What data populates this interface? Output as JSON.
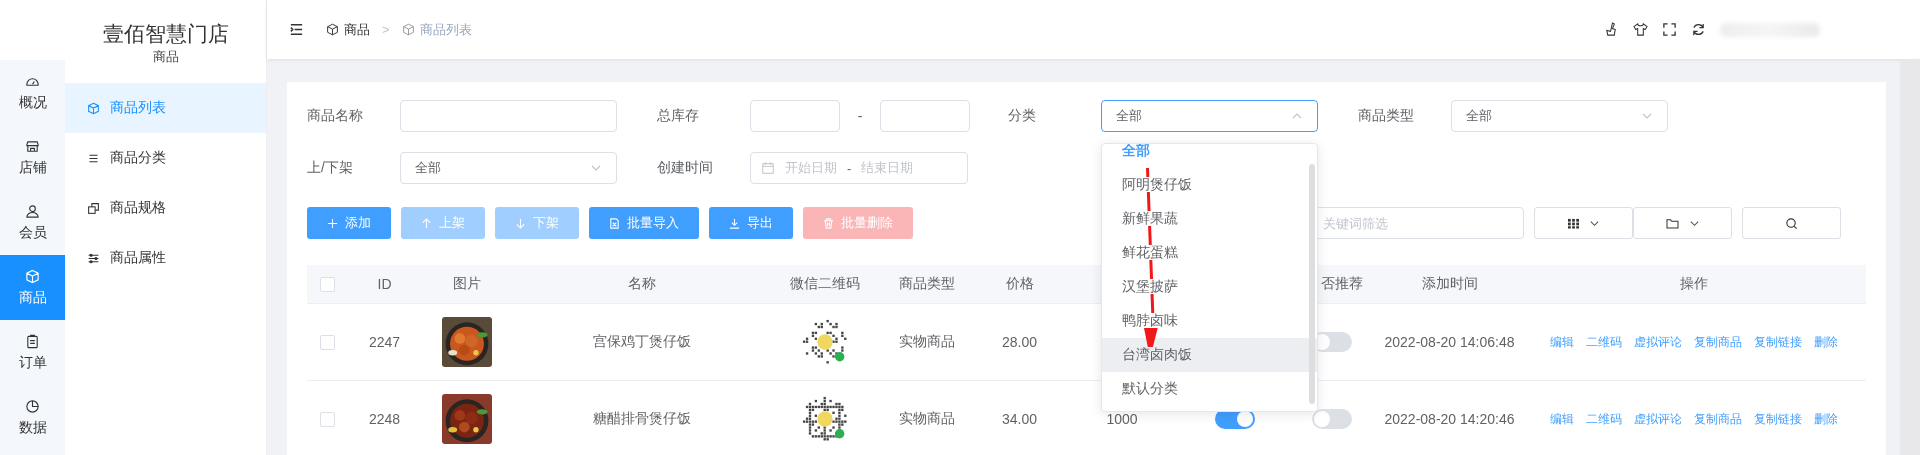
{
  "store": {
    "name": "壹佰智慧门店",
    "section": "商品"
  },
  "nav": [
    {
      "label": "概况",
      "selected": false
    },
    {
      "label": "店铺",
      "selected": false
    },
    {
      "label": "会员",
      "selected": false
    },
    {
      "label": "商品",
      "selected": true
    },
    {
      "label": "订单",
      "selected": false
    },
    {
      "label": "数据",
      "selected": false
    }
  ],
  "submenu": [
    {
      "label": "商品列表",
      "selected": true
    },
    {
      "label": "商品分类",
      "selected": false
    },
    {
      "label": "商品规格",
      "selected": false
    },
    {
      "label": "商品属性",
      "selected": false
    }
  ],
  "breadcrumb": [
    "商品",
    "商品列表"
  ],
  "breadcrumb_separator": ">",
  "filter_rows": [
    [
      {
        "kind": "text",
        "label": "商品名称"
      },
      {
        "kind": "range",
        "label": "总库存",
        "separator": "-"
      },
      {
        "kind": "select",
        "label": "分类",
        "value": "全部",
        "open": true,
        "options": [
          {
            "label": "全部",
            "selected": true,
            "hovered": false
          },
          {
            "label": "阿明煲仔饭",
            "selected": false,
            "hovered": false
          },
          {
            "label": "新鲜果蔬",
            "selected": false,
            "hovered": false
          },
          {
            "label": "鲜花蛋糕",
            "selected": false,
            "hovered": false
          },
          {
            "label": "汉堡披萨",
            "selected": false,
            "hovered": false
          },
          {
            "label": "鸭脖卤味",
            "selected": false,
            "hovered": false
          },
          {
            "label": "台湾卤肉饭",
            "selected": false,
            "hovered": true
          },
          {
            "label": "默认分类",
            "selected": false,
            "hovered": false
          }
        ]
      },
      {
        "kind": "select",
        "label": "商品类型",
        "value": "全部",
        "open": false
      }
    ],
    [
      {
        "kind": "select",
        "label": "上/下架",
        "value": "全部",
        "open": false
      },
      {
        "kind": "daterange",
        "label": "创建时间",
        "start_placeholder": "开始日期",
        "separator": "-",
        "end_placeholder": "结束日期"
      }
    ]
  ],
  "actions": [
    {
      "label": "添加",
      "kind": "primary",
      "disabled": false
    },
    {
      "label": "上架",
      "kind": "primary",
      "disabled": true
    },
    {
      "label": "下架",
      "kind": "primary",
      "disabled": true
    },
    {
      "label": "批量导入",
      "kind": "primary",
      "disabled": false
    },
    {
      "label": "导出",
      "kind": "primary",
      "disabled": false
    },
    {
      "label": "批量删除",
      "kind": "danger",
      "disabled": true
    }
  ],
  "keyword_search": {
    "placeholder": "关键词筛选"
  },
  "table": {
    "header_checked": false,
    "columns": [
      "ID",
      "图片",
      "名称",
      "微信二维码",
      "商品类型",
      "价格",
      "否推荐",
      "添加时间",
      "操作"
    ],
    "rows": [
      {
        "checked": false,
        "id": "2247",
        "name": "宫保鸡丁煲仔饭",
        "type": "实物商品",
        "price": "28.00",
        "recommended": false,
        "added": "2022-08-20 14:06:48",
        "actions": [
          "编辑",
          "二维码",
          "虚拟评论",
          "复制商品",
          "复制链接",
          "删除"
        ]
      },
      {
        "checked": false,
        "id": "2248",
        "name": "糖醋排骨煲仔饭",
        "type": "实物商品",
        "price": "34.00",
        "stock": "1000",
        "on_sale": true,
        "recommended": false,
        "added": "2022-08-20 14:20:46",
        "actions": [
          "编辑",
          "二维码",
          "虚拟评论",
          "复制商品",
          "复制链接",
          "删除"
        ]
      }
    ]
  }
}
